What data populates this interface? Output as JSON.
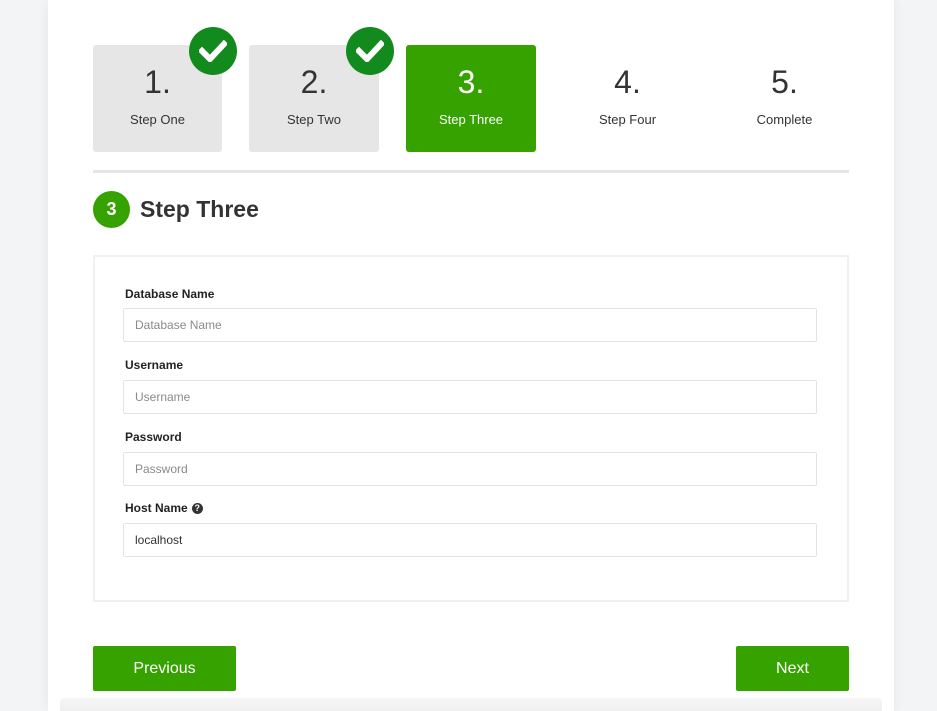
{
  "steps": [
    {
      "number": "1.",
      "label": "Step One",
      "state": "done"
    },
    {
      "number": "2.",
      "label": "Step Two",
      "state": "done"
    },
    {
      "number": "3.",
      "label": "Step Three",
      "state": "active"
    },
    {
      "number": "4.",
      "label": "Step Four",
      "state": "todo"
    },
    {
      "number": "5.",
      "label": "Complete",
      "state": "todo"
    }
  ],
  "section": {
    "badge": "3",
    "title": "Step Three"
  },
  "form": {
    "db_name": {
      "label": "Database Name",
      "placeholder": "Database Name",
      "value": ""
    },
    "username": {
      "label": "Username",
      "placeholder": "Username",
      "value": ""
    },
    "password": {
      "label": "Password",
      "placeholder": "Password",
      "value": ""
    },
    "host": {
      "label": "Host Name",
      "placeholder": "",
      "value": "localhost",
      "help_icon": "question-circle-icon"
    }
  },
  "buttons": {
    "previous": "Previous",
    "next": "Next"
  },
  "colors": {
    "accent": "#35a200",
    "check": "#138a1e",
    "done_bg": "#e6e6e6"
  }
}
